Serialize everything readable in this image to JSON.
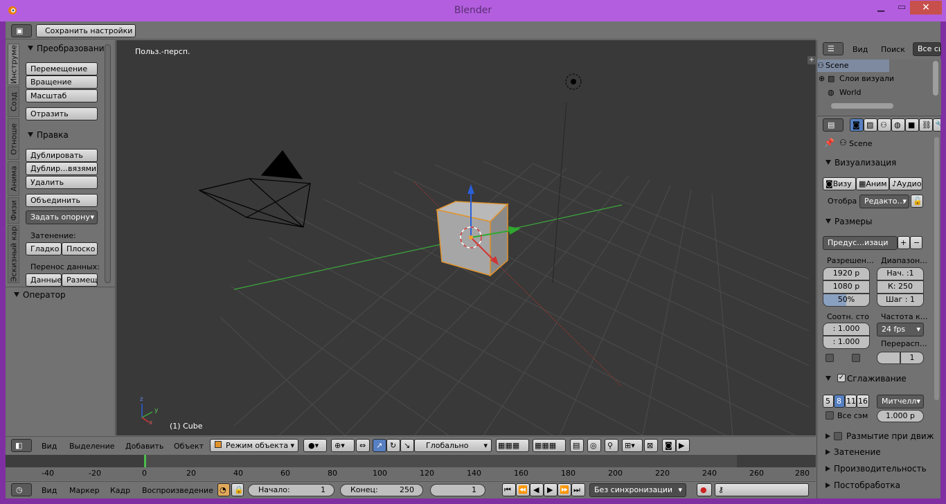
{
  "window": {
    "title": "Blender"
  },
  "topbar": {
    "save_settings": "Сохранить настройки"
  },
  "toolshelf": {
    "tabs": [
      "Инструме",
      "Созд",
      "Отноше",
      "Анима",
      "Физи",
      "Эскизный кар"
    ],
    "transform_header": "Преобразовани",
    "translate": "Перемещение",
    "rotate": "Вращение",
    "scale": "Масштаб",
    "mirror": "Отразить",
    "edit_header": "Правка",
    "duplicate": "Дублировать",
    "duplicate_linked": "Дублир…вязями",
    "delete": "Удалить",
    "join": "Объединить",
    "set_origin": "Задать опорну",
    "shading_label": "Затенение:",
    "smooth": "Гладко",
    "flat": "Плоско",
    "data_transfer_label": "Перенос данных:",
    "data": "Данные",
    "layout": "Размещ",
    "operator_header": "Оператор"
  },
  "viewport": {
    "view_label": "Польз.-персп.",
    "object_label": "(1) Cube",
    "axis_x": "x",
    "axis_y": "y",
    "axis_z": "z"
  },
  "view3d_header": {
    "view": "Вид",
    "select": "Выделение",
    "add": "Добавить",
    "object": "Объект",
    "mode": "Режим объекта",
    "orientation": "Глобально"
  },
  "timeline": {
    "ticks": [
      "-40",
      "-20",
      "0",
      "20",
      "40",
      "60",
      "80",
      "100",
      "120",
      "140",
      "160",
      "180",
      "200",
      "220",
      "240",
      "260",
      "280"
    ],
    "view": "Вид",
    "marker": "Маркер",
    "frame": "Кадр",
    "playback": "Воспроизведение",
    "start_label": "Начало:",
    "start_value": "1",
    "end_label": "Конец:",
    "end_value": "250",
    "current_frame": "1",
    "sync": "Без синхронизации"
  },
  "outliner": {
    "view": "Вид",
    "search": "Поиск",
    "filter": "Все сц",
    "items": [
      "Scene",
      "Слои визуали",
      "World"
    ]
  },
  "properties": {
    "scene_name": "Scene",
    "render_header": "Визуализация",
    "render_btn": "Визу",
    "anim_btn": "Аним",
    "audio_btn": "Аудио",
    "display_label": "Отобра",
    "display_value": "Редакто…",
    "dimensions_header": "Размеры",
    "preset": "Предус…изаци",
    "resolution_label": "Разрешен…",
    "frame_range_label": "Диапазон…",
    "res_x": "1920 р",
    "res_y": "1080 р",
    "res_pct": "50%",
    "start": "Нач. :1",
    "end": "К: 250",
    "step": "Шаг : 1",
    "aspect_label": "Соотн. сто",
    "aspect_x": ": 1.000",
    "aspect_y": ": 1.000",
    "fps_label": "Частота к…",
    "fps": "24 fps",
    "remap_label": "Перерасп…",
    "remap_value": "1",
    "aa_header": "Сглаживание",
    "aa_samples": [
      "5",
      "8",
      "11",
      "16"
    ],
    "aa_filter": "Митчелл",
    "full_sample": "Все сэм",
    "filter_size": "1.000 р",
    "motion_blur_header": "Размытие при движ",
    "shading_header": "Затенение",
    "performance_header": "Производительность",
    "postprocess_header": "Постобработка"
  },
  "colors": {
    "accent_selected": "#5680c2",
    "viewport_bg": "#393939",
    "window_frame": "#b35edf"
  }
}
